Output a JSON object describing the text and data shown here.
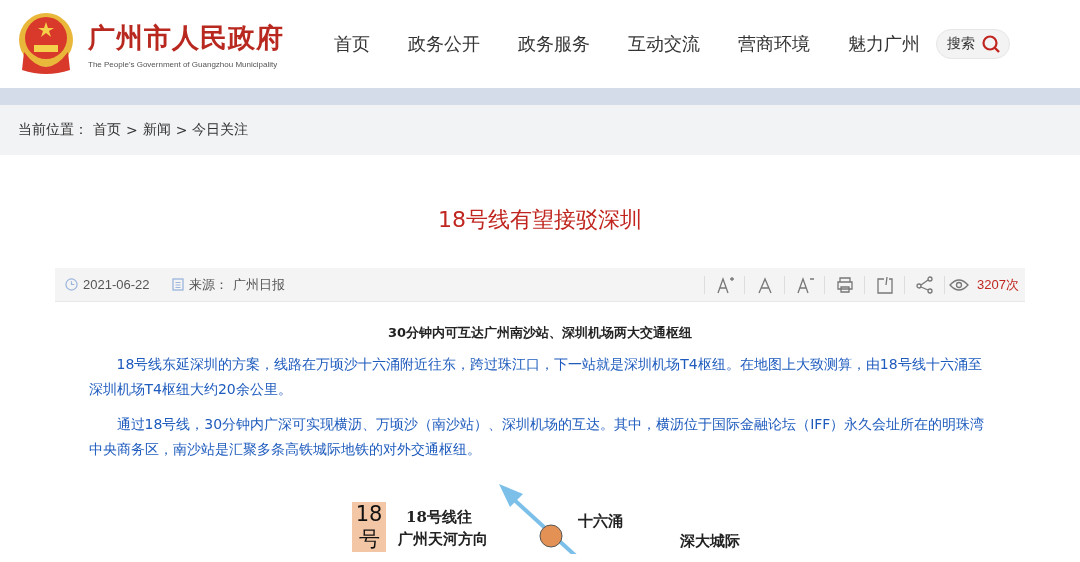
{
  "header": {
    "site_name": "广州市人民政府",
    "site_name_en": "The People's Government of Guangzhou Municipality",
    "nav": [
      {
        "label": "首页"
      },
      {
        "label": "政务公开"
      },
      {
        "label": "政务服务"
      },
      {
        "label": "互动交流"
      },
      {
        "label": "营商环境"
      },
      {
        "label": "魅力广州"
      }
    ],
    "search_label": "搜索"
  },
  "breadcrumb": {
    "prefix": "当前位置：",
    "items": [
      "首页",
      "新闻",
      "今日关注"
    ],
    "separator": ">"
  },
  "article": {
    "title": "18号线有望接驳深圳",
    "meta": {
      "date": "2021-06-22",
      "source_label": "来源：",
      "source": "广州日报",
      "views": "3207次",
      "tools": [
        {
          "kind": "font-larger"
        },
        {
          "kind": "font-normal"
        },
        {
          "kind": "font-smaller"
        },
        {
          "kind": "print"
        },
        {
          "kind": "export"
        },
        {
          "kind": "share"
        }
      ]
    },
    "subtitle": "30分钟内可互达广州南沙站、深圳机场两大交通枢纽",
    "paragraphs": [
      "18号线东延深圳的方案，线路在万顷沙十六涌附近往东，跨过珠江口，下一站就是深圳机场T4枢纽。在地图上大致测算，由18号线十六涌至深圳机场T4枢纽大约20余公里。",
      "通过18号线，30分钟内广深可实现横沥、万顷沙（南沙站）、深圳机场的互达。其中，横沥位于国际金融论坛（IFF）永久会址所在的明珠湾中央商务区，南沙站是汇聚多条高铁城际地铁的对外交通枢纽。"
    ],
    "figure": {
      "line_badge": "18号",
      "direction_label": [
        "18号线往",
        "广州天河方向"
      ],
      "station_label": "十六涌",
      "intercity_label": "深大城际"
    }
  }
}
